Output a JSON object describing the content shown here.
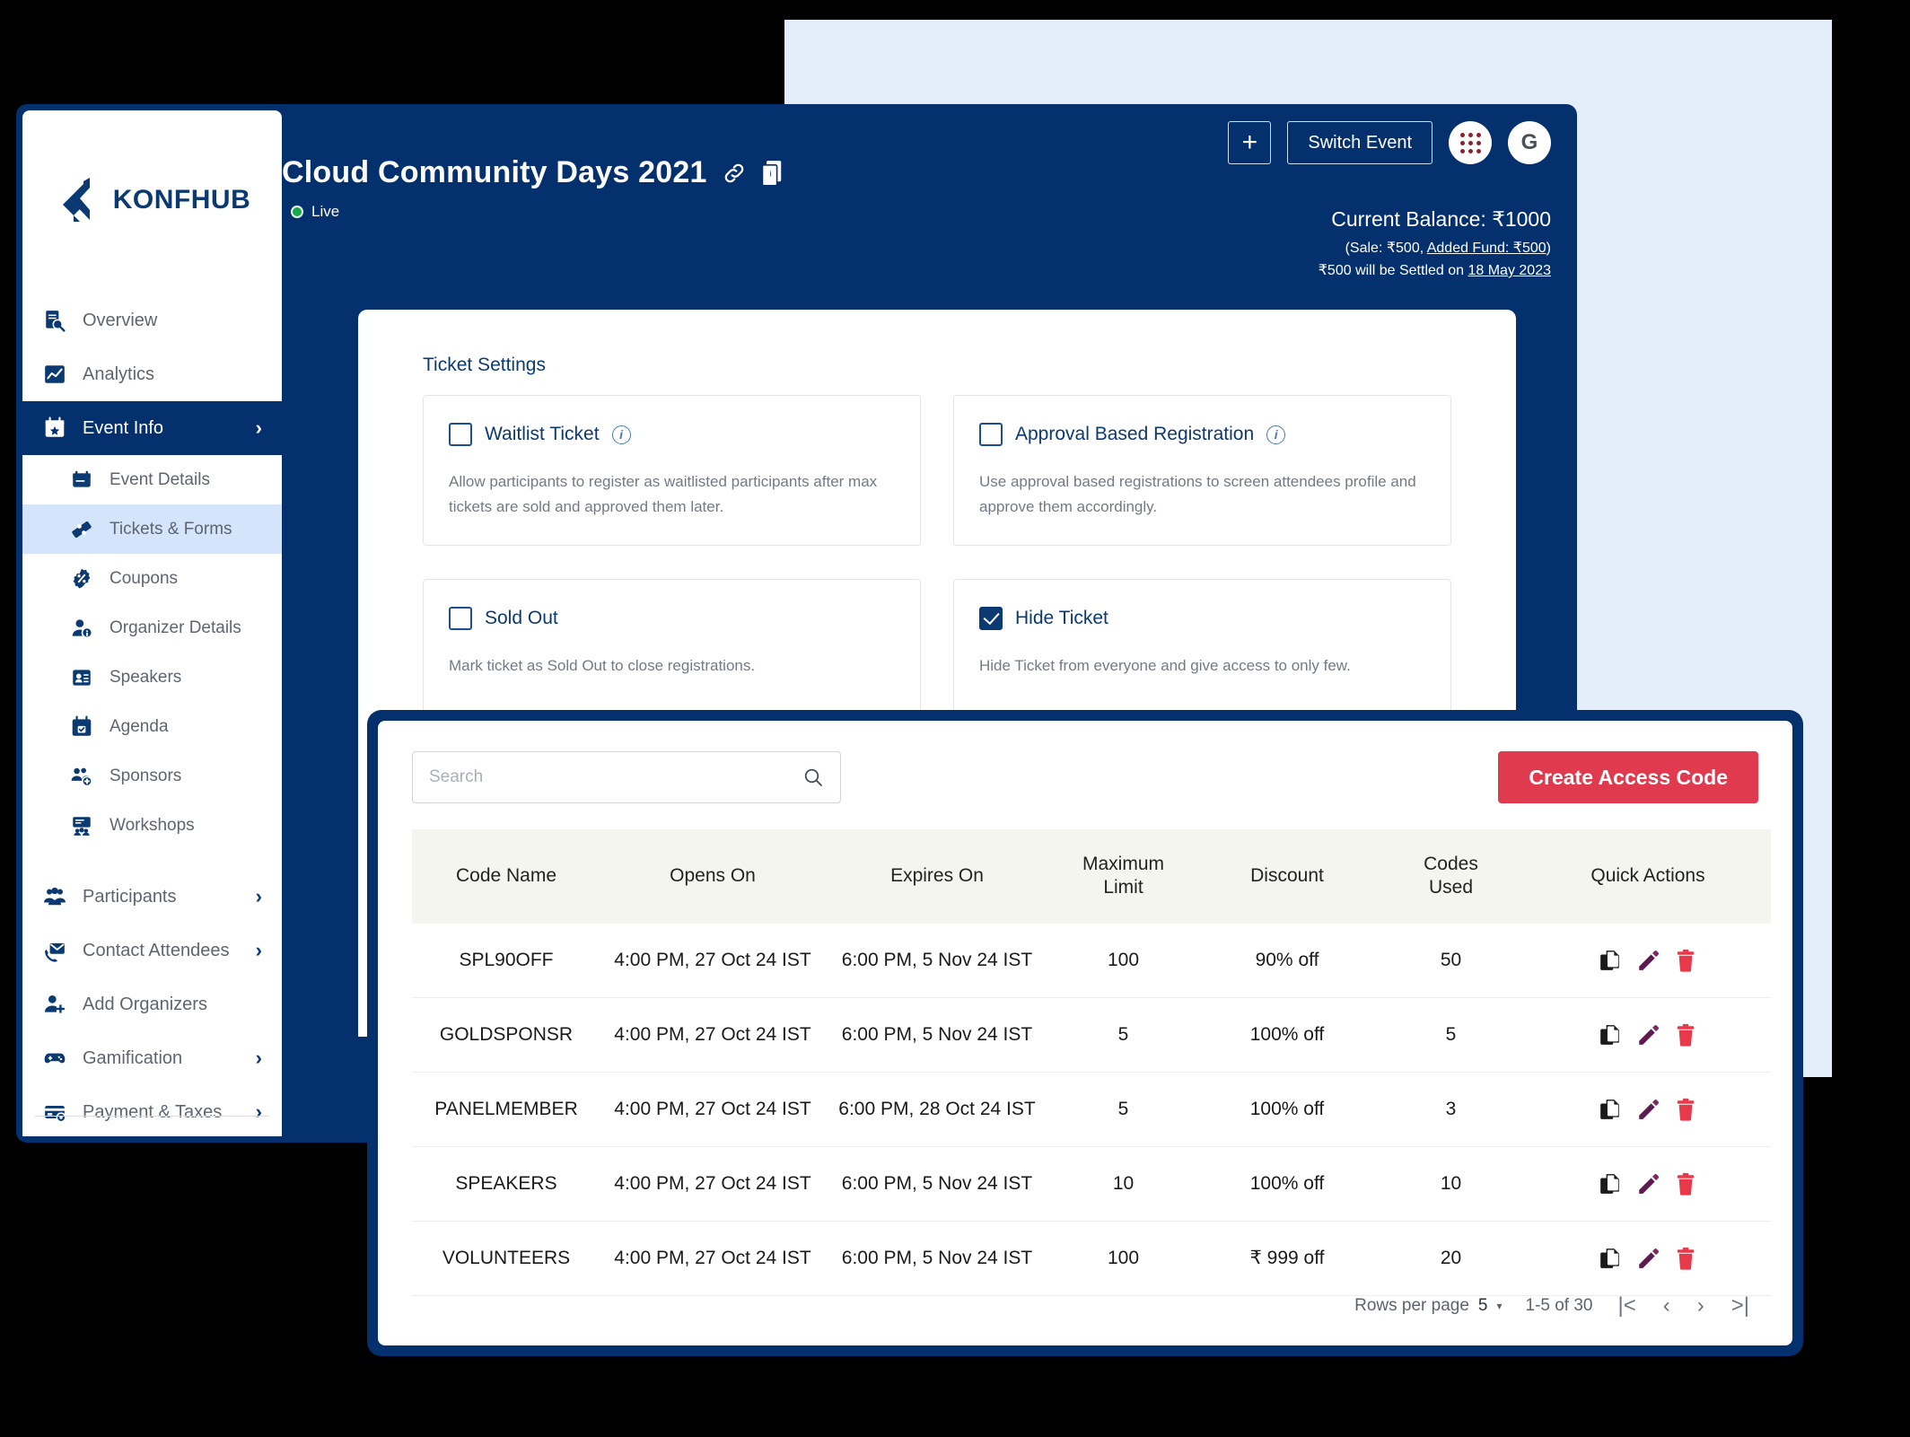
{
  "brand": {
    "name": "KONFHUB",
    "logo_icon": "konfhub-logo-icon",
    "navy": "#05306e",
    "accent_red": "#e03a4e",
    "light_blue": "#e4eefb"
  },
  "sidebar": {
    "items": [
      {
        "label": "Overview",
        "icon": "overview-document-search-icon",
        "chevron": "",
        "state": "default",
        "level": "top"
      },
      {
        "label": "Analytics",
        "icon": "analytics-chart-icon",
        "chevron": "",
        "state": "default",
        "level": "top"
      },
      {
        "label": "Event Info",
        "icon": "event-info-calendar-star-icon",
        "chevron": "›",
        "state": "active",
        "level": "top"
      },
      {
        "label": "Event Details",
        "icon": "event-details-card-icon",
        "chevron": "",
        "state": "default",
        "level": "sub"
      },
      {
        "label": "Tickets & Forms",
        "icon": "ticket-icon",
        "chevron": "",
        "state": "selected",
        "level": "sub"
      },
      {
        "label": "Coupons",
        "icon": "coupon-percent-icon",
        "chevron": "",
        "state": "default",
        "level": "sub"
      },
      {
        "label": "Organizer Details",
        "icon": "organizer-person-info-icon",
        "chevron": "",
        "state": "default",
        "level": "sub"
      },
      {
        "label": "Speakers",
        "icon": "speaker-badge-icon",
        "chevron": "",
        "state": "default",
        "level": "sub"
      },
      {
        "label": "Agenda",
        "icon": "agenda-calendar-icon",
        "chevron": "",
        "state": "default",
        "level": "sub"
      },
      {
        "label": "Sponsors",
        "icon": "sponsors-people-add-icon",
        "chevron": "",
        "state": "default",
        "level": "sub"
      },
      {
        "label": "Workshops",
        "icon": "workshops-presentation-icon",
        "chevron": "",
        "state": "default",
        "level": "sub"
      },
      {
        "label": "Participants",
        "icon": "participants-group-icon",
        "chevron": "›",
        "state": "default",
        "level": "top"
      },
      {
        "label": "Contact Attendees",
        "icon": "contact-mail-phone-icon",
        "chevron": "›",
        "state": "default",
        "level": "top"
      },
      {
        "label": "Add Organizers",
        "icon": "add-organizer-person-plus-icon",
        "chevron": "",
        "state": "default",
        "level": "top"
      },
      {
        "label": "Gamification",
        "icon": "gamification-gamepad-icon",
        "chevron": "›",
        "state": "default",
        "level": "top"
      },
      {
        "label": "Payment & Taxes",
        "icon": "payment-card-gear-icon",
        "chevron": "›",
        "state": "default",
        "level": "top"
      }
    ]
  },
  "header": {
    "event_title": "Cloud Community Days 2021",
    "link_icon": "link-chain-icon",
    "copy_icon": "copy-page-icon",
    "status_label": "Live",
    "status_color": "#17a948",
    "add_button_label": "+",
    "switch_event_label": "Switch Event",
    "apps_icon": "apps-grid-icon",
    "avatar_letter": "G",
    "balance_main": "Current Balance: ₹1000",
    "balance_sub_prefix": "(Sale: ₹500, ",
    "balance_sub_link": "Added Fund: ₹500",
    "balance_sub_suffix": ")",
    "settle_prefix": "₹500 will be Settled on ",
    "settle_date": "18 May 2023"
  },
  "ticket_settings": {
    "section_title": "Ticket Settings",
    "info_icon": "info-circle-icon",
    "options": [
      {
        "label": "Waitlist Ticket",
        "checked": false,
        "has_info": true,
        "description": "Allow participants to register as waitlisted participants after max tickets are sold and approved them later."
      },
      {
        "label": "Approval Based Registration",
        "checked": false,
        "has_info": true,
        "description": "Use approval based registrations to screen attendees profile and approve them accordingly."
      },
      {
        "label": "Sold Out",
        "checked": false,
        "has_info": false,
        "description": "Mark ticket as Sold Out to close registrations."
      },
      {
        "label": "Hide Ticket",
        "checked": true,
        "has_info": false,
        "description": "Hide Ticket from everyone and give access to only few."
      }
    ]
  },
  "access_codes": {
    "search": {
      "value": "",
      "placeholder": "Search",
      "icon": "search-icon"
    },
    "create_button_label": "Create Access Code",
    "columns": [
      "Code Name",
      "Opens On",
      "Expires On",
      "Maximum Limit",
      "Discount",
      "Codes Used",
      "Quick Actions"
    ],
    "quick_action_icons": [
      "copy-icon",
      "edit-pencil-icon",
      "delete-trash-icon"
    ],
    "rows": [
      {
        "code_name": "SPL90OFF",
        "opens_on": "4:00 PM, 27 Oct 24 IST",
        "expires_on": "6:00 PM, 5 Nov 24 IST",
        "maximum_limit": "100",
        "discount": "90% off",
        "codes_used": "50"
      },
      {
        "code_name": "GOLDSPONSR",
        "opens_on": "4:00 PM, 27 Oct 24 IST",
        "expires_on": "6:00 PM, 5 Nov 24 IST",
        "maximum_limit": "5",
        "discount": "100% off",
        "codes_used": "5"
      },
      {
        "code_name": "PANELMEMBER",
        "opens_on": "4:00 PM, 27 Oct 24 IST",
        "expires_on": "6:00 PM, 28 Oct 24 IST",
        "maximum_limit": "5",
        "discount": "100% off",
        "codes_used": "3"
      },
      {
        "code_name": "SPEAKERS",
        "opens_on": "4:00 PM, 27 Oct 24 IST",
        "expires_on": "6:00 PM, 5 Nov 24 IST",
        "maximum_limit": "10",
        "discount": "100% off",
        "codes_used": "10"
      },
      {
        "code_name": "VOLUNTEERS",
        "opens_on": "4:00 PM, 27 Oct 24 IST",
        "expires_on": "6:00 PM, 5 Nov 24 IST",
        "maximum_limit": "100",
        "discount": "₹ 999 off",
        "codes_used": "20"
      }
    ],
    "pagination": {
      "rows_per_page_label": "Rows per page",
      "rows_per_page_value": "5",
      "range_label": "1-5 of 30",
      "first_icon": "|<",
      "prev_icon": "‹",
      "next_icon": "›",
      "last_icon": ">|"
    }
  }
}
